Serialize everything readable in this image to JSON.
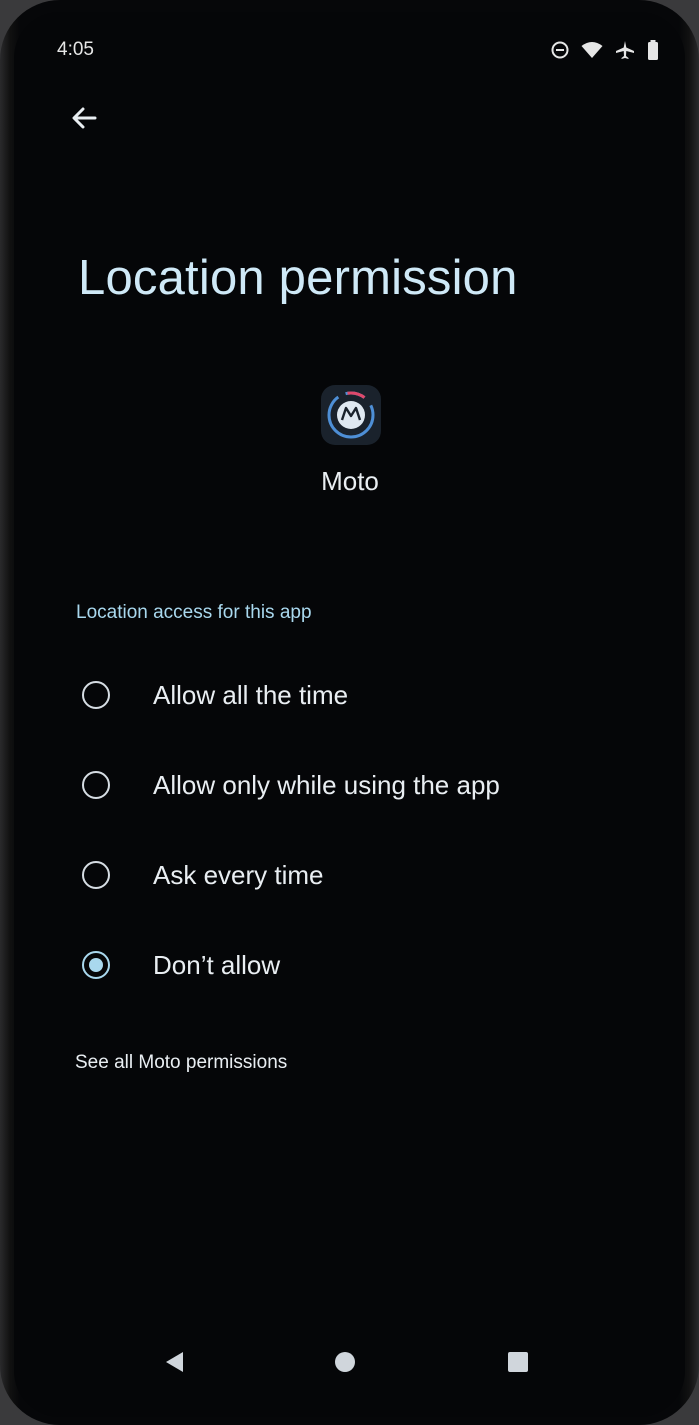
{
  "status_bar": {
    "time": "4:05",
    "icons": [
      "do-not-disturb-icon",
      "wifi-icon",
      "airplane-icon",
      "battery-icon"
    ]
  },
  "header": {
    "back_icon": "back-arrow-icon",
    "title": "Location permission"
  },
  "app": {
    "icon": "moto-app-icon",
    "name": "Moto"
  },
  "permissions": {
    "section_label": "Location access for this app",
    "options": [
      {
        "label": "Allow all the time",
        "selected": false
      },
      {
        "label": "Allow only while using the app",
        "selected": false
      },
      {
        "label": "Ask every time",
        "selected": false
      },
      {
        "label": "Don’t allow",
        "selected": true
      }
    ],
    "see_all_link": "See all Moto permissions"
  },
  "nav_bar": {
    "back": "nav-back-icon",
    "home": "nav-home-icon",
    "recents": "nav-recents-icon"
  },
  "colors": {
    "background": "#050608",
    "accent": "#a9d8ee",
    "title": "#cfe9f7",
    "text": "#e9eef2"
  }
}
